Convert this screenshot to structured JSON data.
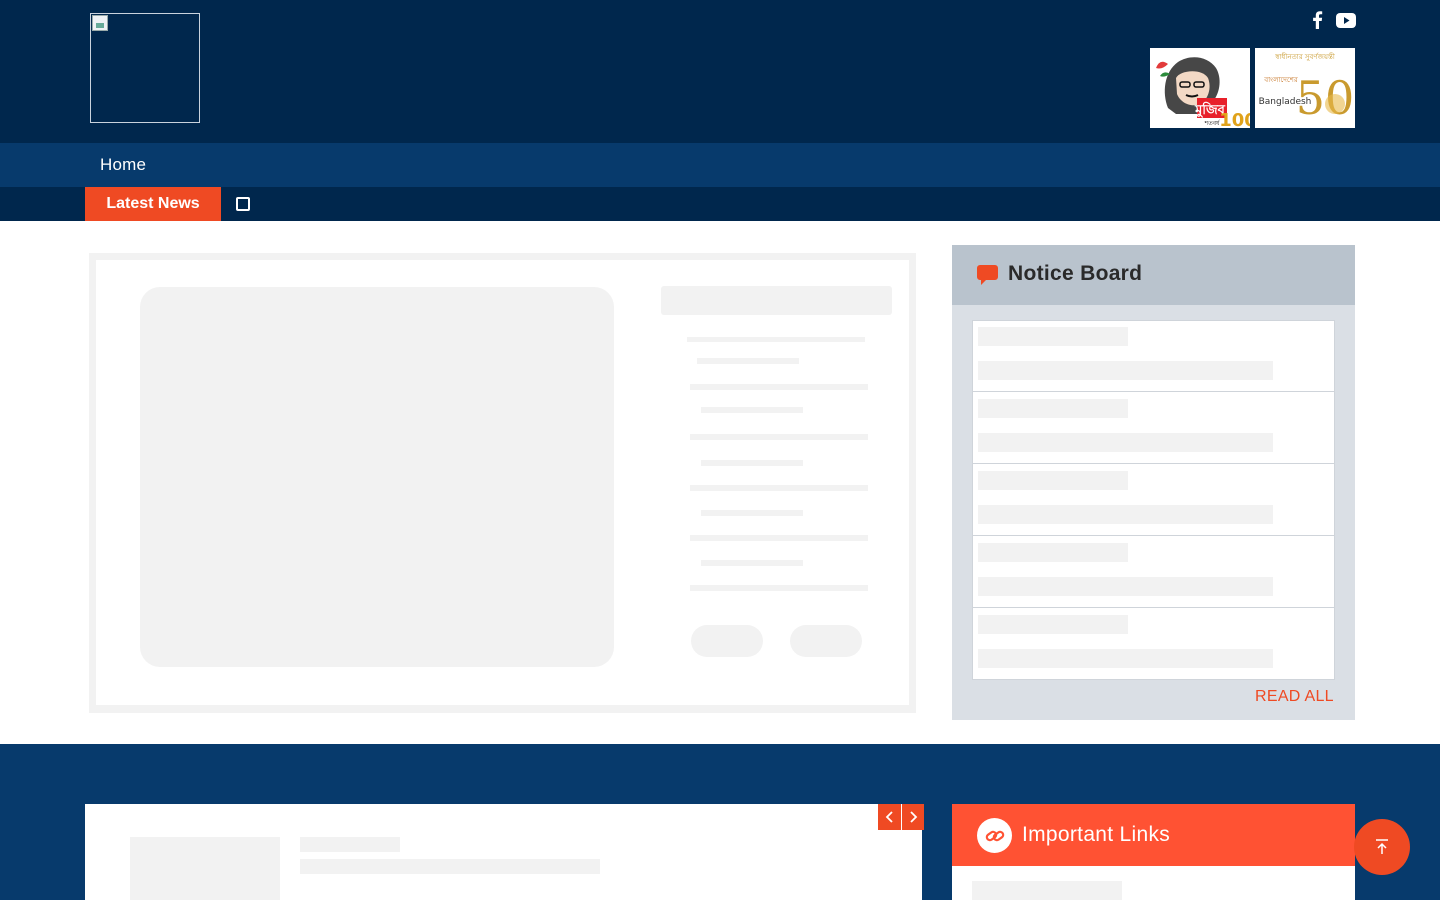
{
  "header": {
    "logo_alt": "",
    "social": [
      "facebook-icon",
      "youtube-icon"
    ],
    "banners": [
      "mujib-100-banner",
      "bangladesh-50-banner"
    ],
    "mujib_banner": {
      "text_a": "মুজিব",
      "text_b": "শতবর্ষ",
      "text_c": "100"
    },
    "bd50_banner": {
      "text_a": "স্বাধীনতার সুবর্ণজয়ন্তী",
      "text_b": "বাংলাদেশের",
      "text_c": "Bangladesh",
      "text_d": "50"
    }
  },
  "nav": {
    "home_label": "Home"
  },
  "ticker": {
    "label": "Latest News"
  },
  "notice_board": {
    "title": "Notice Board",
    "read_all": "READ ALL"
  },
  "important_links": {
    "title": "Important Links"
  },
  "colors": {
    "navy": "#00274d",
    "blue": "#073a6c",
    "accent": "#ef4a23",
    "skeleton": "#f2f2f2"
  }
}
